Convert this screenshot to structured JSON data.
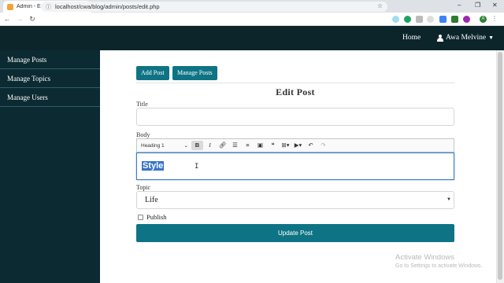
{
  "browser": {
    "tab_title": "Admin - Edit Post",
    "tab_close": "×",
    "new_tab": "+",
    "url": "localhost/cwa/blog/admin/posts/edit.php",
    "win_minimize": "–",
    "win_restore": "❐",
    "win_close": "✕",
    "profile_initial": "A"
  },
  "header": {
    "home_label": "Home",
    "user_name": "Awa Melvine"
  },
  "sidebar": {
    "items": [
      {
        "label": "Manage Posts"
      },
      {
        "label": "Manage Topics"
      },
      {
        "label": "Manage Users"
      }
    ]
  },
  "main": {
    "add_post_label": "Add Post",
    "manage_posts_label": "Manage Posts",
    "page_title": "Edit Post",
    "title_label": "Title",
    "title_value": "",
    "body_label": "Body",
    "editor": {
      "heading_select": "Heading 1",
      "content": "Style"
    },
    "topic_label": "Topic",
    "topic_value": "Life",
    "publish_label": "Publish",
    "update_button": "Update Post"
  },
  "watermark": {
    "line1": "Activate Windows",
    "line2": "Go to Settings to activate Windows."
  },
  "colors": {
    "header_bg": "#0b252b",
    "sidebar_bg": "#0b2a31",
    "accent": "#0e7485",
    "selection": "#3873c4"
  }
}
